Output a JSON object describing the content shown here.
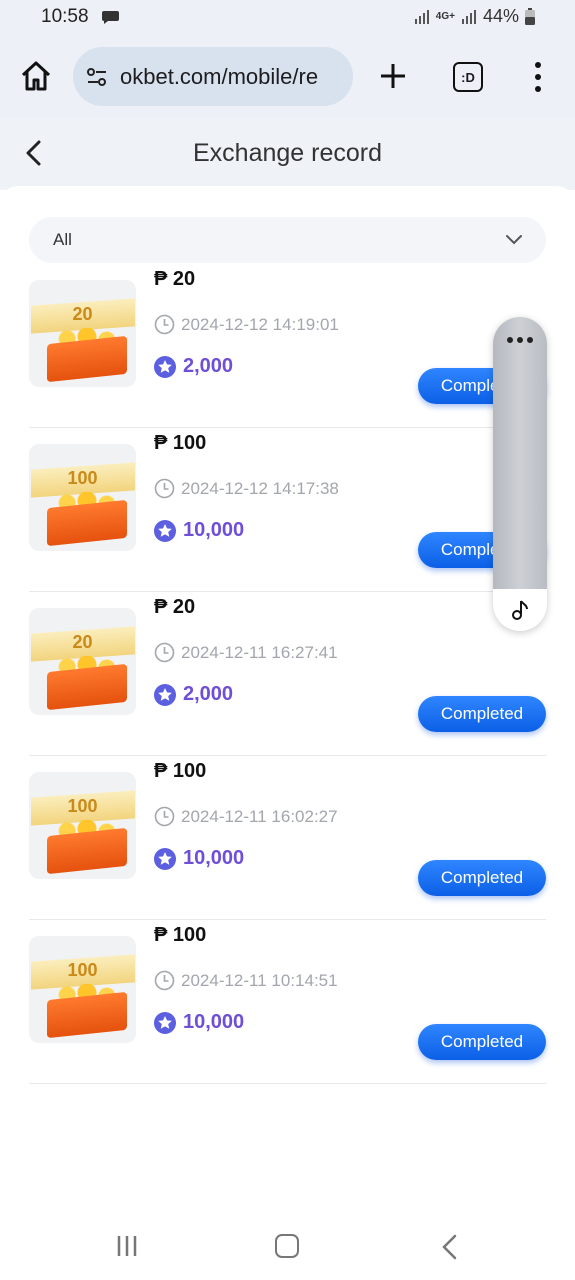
{
  "status_bar": {
    "time": "10:58",
    "network": "4G+",
    "battery": "44%",
    "icons": [
      "chat-icon",
      "signal-icon",
      "battery-icon"
    ]
  },
  "browser": {
    "url": "okbet.com/mobile/re",
    "tabs_label": ":D"
  },
  "header": {
    "title": "Exchange record"
  },
  "filter": {
    "selected": "All"
  },
  "records": [
    {
      "thumb_label": "20",
      "amount": "₱ 20",
      "time": "2024-12-12 14:19:01",
      "points": "2,000",
      "status": "Completed"
    },
    {
      "thumb_label": "100",
      "amount": "₱ 100",
      "time": "2024-12-12 14:17:38",
      "points": "10,000",
      "status": "Completed"
    },
    {
      "thumb_label": "20",
      "amount": "₱ 20",
      "time": "2024-12-11 16:27:41",
      "points": "2,000",
      "status": "Completed"
    },
    {
      "thumb_label": "100",
      "amount": "₱ 100",
      "time": "2024-12-11 16:02:27",
      "points": "10,000",
      "status": "Completed"
    },
    {
      "thumb_label": "100",
      "amount": "₱ 100",
      "time": "2024-12-11 10:14:51",
      "points": "10,000",
      "status": "Completed"
    }
  ],
  "colors": {
    "accent": "#1668f0",
    "points": "#6f4fd7"
  }
}
